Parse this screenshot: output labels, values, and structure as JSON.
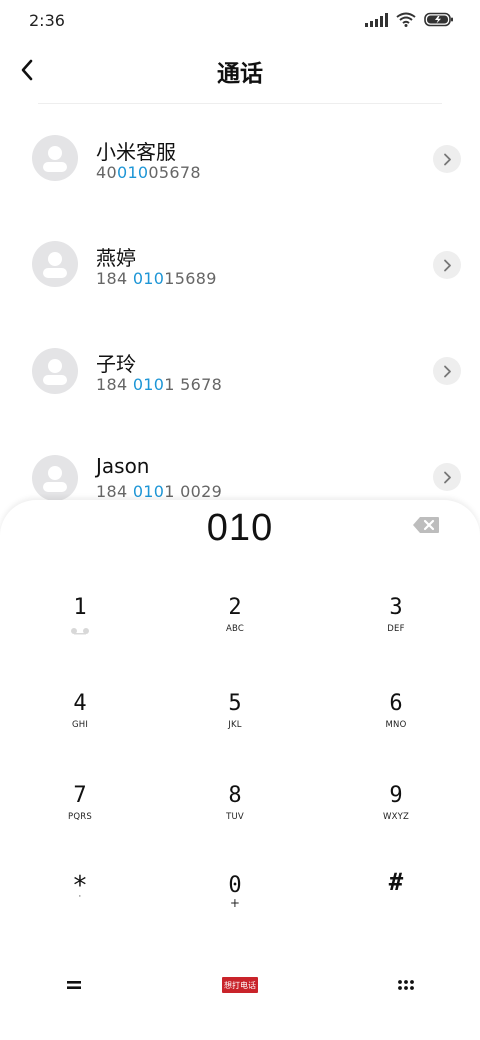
{
  "status": {
    "time": "2:36",
    "icons": [
      "signal-icon",
      "wifi-icon",
      "battery-charging-icon"
    ]
  },
  "header": {
    "back_icon": "chevron-left-icon",
    "title": "通话"
  },
  "contacts": [
    {
      "name": "小米客服",
      "number_pre": "40",
      "number_hl": "010",
      "number_post": "05678"
    },
    {
      "name": "燕婷",
      "number_pre": "184 ",
      "number_hl": "010",
      "number_post": "15689"
    },
    {
      "name": "子玲",
      "number_pre": "184 ",
      "number_hl": "010",
      "number_post": "1 5678"
    },
    {
      "name": "Jason",
      "number_pre": "184 ",
      "number_hl": "010",
      "number_post": "1 0029"
    }
  ],
  "dialpad": {
    "input_value": "010",
    "keys": [
      {
        "digit": "1",
        "letters": ""
      },
      {
        "digit": "2",
        "letters": "ABC"
      },
      {
        "digit": "3",
        "letters": "DEF"
      },
      {
        "digit": "4",
        "letters": "GHI"
      },
      {
        "digit": "5",
        "letters": "JKL"
      },
      {
        "digit": "6",
        "letters": "MNO"
      },
      {
        "digit": "7",
        "letters": "PQRS"
      },
      {
        "digit": "8",
        "letters": "TUV"
      },
      {
        "digit": "9",
        "letters": "WXYZ"
      },
      {
        "digit": "*",
        "letters": "·"
      },
      {
        "digit": "0",
        "letters": "+"
      },
      {
        "digit": "#",
        "letters": ""
      }
    ],
    "call_label": "想打电话"
  },
  "colors": {
    "highlight": "#1e96d6",
    "call_button": "#c9232a"
  }
}
